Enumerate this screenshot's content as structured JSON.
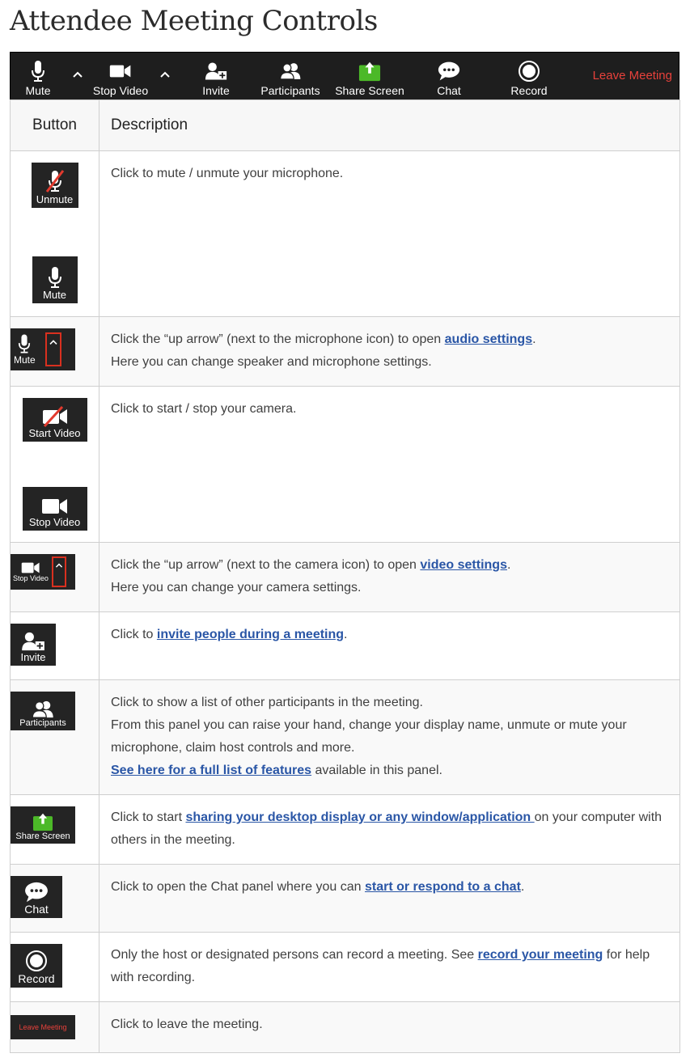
{
  "page": {
    "title": "Attendee Meeting Controls"
  },
  "toolbar": {
    "mute": "Mute",
    "stop_video": "Stop Video",
    "invite": "Invite",
    "participants": "Participants",
    "share_screen": "Share Screen",
    "chat": "Chat",
    "record": "Record",
    "leave_meeting": "Leave Meeting"
  },
  "table": {
    "headers": {
      "button": "Button",
      "description": "Description"
    },
    "rows": {
      "mute": {
        "btn_top": "Unmute",
        "btn_bottom": "Mute",
        "text": "Click to mute / unmute your microphone."
      },
      "audio": {
        "btn": "Mute",
        "pre": "Click the “up arrow” (next to the microphone icon) to open ",
        "link": "audio settings",
        "post": ".",
        "line2": "Here you can change speaker and microphone settings."
      },
      "video": {
        "btn_top": "Start Video",
        "btn_bottom": "Stop Video",
        "text": "Click to start / stop your camera."
      },
      "video_settings": {
        "btn": "Stop Video",
        "pre": "Click the “up arrow” (next to the camera icon) to open ",
        "link": "video settings",
        "post": ".",
        "line2": "Here you can change your camera settings."
      },
      "invite": {
        "btn": "Invite",
        "pre": "Click to ",
        "link": "invite people during a meeting",
        "post": "."
      },
      "participants": {
        "btn": "Participants",
        "line1": "Click to show a list of other participants in the meeting.",
        "line2": "From this panel you can raise your hand, change your display name, unmute or mute your microphone, claim host controls and more.",
        "link": "See here for a full list of features",
        "post": " available in this panel."
      },
      "share": {
        "btn": "Share Screen",
        "pre": "Click to start ",
        "link": "sharing your desktop display or any window/application ",
        "post": "on your computer with others in the meeting."
      },
      "chat": {
        "btn": "Chat",
        "pre": "Click to open the Chat panel where you can ",
        "link": "start or respond to a chat",
        "post": "."
      },
      "record": {
        "btn": "Record",
        "pre": "Only the host or designated persons can record a meeting. See ",
        "link": "record your meeting",
        "post": " for help with recording."
      },
      "leave": {
        "btn": "Leave Meeting",
        "text": "Click to leave the meeting."
      }
    }
  },
  "colors": {
    "toolbar_bg": "#1e1e1e",
    "leave_red": "#e8413b",
    "share_green": "#4cb928",
    "link_blue": "#2a56a6"
  }
}
